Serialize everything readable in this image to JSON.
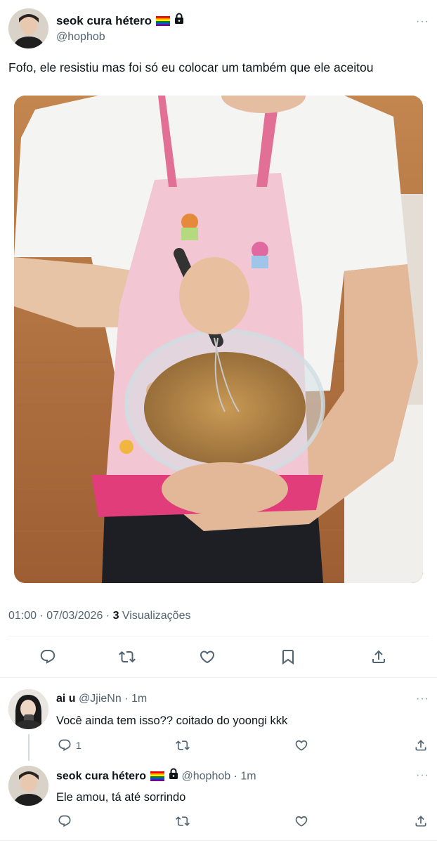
{
  "tweet": {
    "author_name": "seok cura hétero",
    "author_handle": "@hophob",
    "text": "Fofo, ele resistiu mas foi só eu colocar um também que ele aceitou",
    "time": "01:00",
    "date": "07/03/2026",
    "views_count": "3",
    "views_label": "Visualizações",
    "separator": " · ",
    "more": "···"
  },
  "actions": {
    "reply_icon": "reply-icon",
    "retweet_icon": "retweet-icon",
    "like_icon": "heart-icon",
    "bookmark_icon": "bookmark-icon",
    "share_icon": "share-icon"
  },
  "replies": [
    {
      "name": "ai u",
      "handle": "@JjieNn",
      "time": "1m",
      "text": "Você ainda tem isso?? coitado do yoongi kkk",
      "reply_count": "1",
      "more": "···"
    },
    {
      "name": "seok cura hétero",
      "handle": "@hophob",
      "time": "1m",
      "text": "Ele amou, tá até sorrindo",
      "reply_count": "",
      "more": "···"
    }
  ],
  "colors": {
    "text": "#0f1419",
    "secondary": "#536471",
    "divider": "#eff3f4",
    "thread_line": "#cfd9de"
  }
}
